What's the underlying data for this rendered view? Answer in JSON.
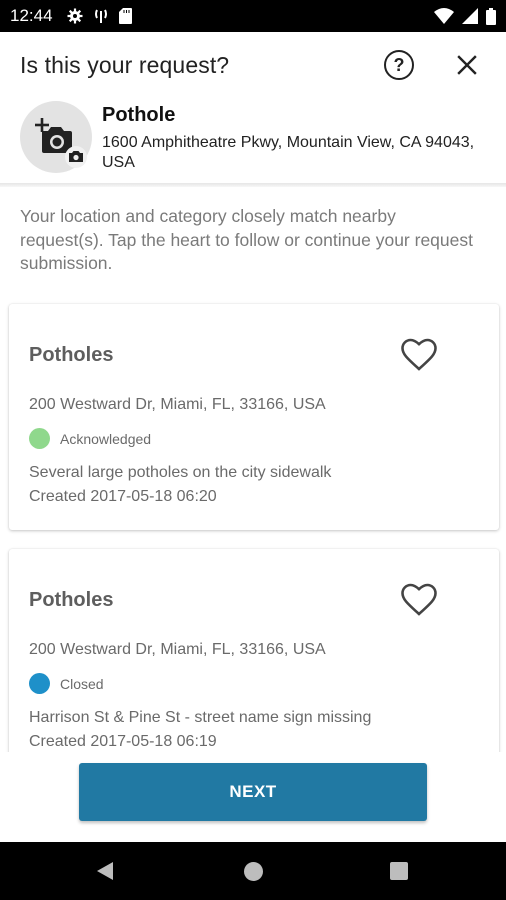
{
  "status_bar": {
    "time": "12:44",
    "left_icons": [
      "gear-icon",
      "antenna-icon",
      "sd-card-icon"
    ],
    "right_icons": [
      "wifi-icon",
      "signal-icon",
      "battery-icon"
    ]
  },
  "header": {
    "title": "Is this your request?",
    "help_icon": "help-circle-icon",
    "close_icon": "close-icon"
  },
  "request": {
    "category": "Pothole",
    "address": "1600 Amphitheatre Pkwy, Mountain View, CA 94043, USA",
    "photo_icon": "add-photo-icon"
  },
  "info_text": "Your location and category closely match nearby request(s). Tap the heart to follow or continue your request submission.",
  "nearby_requests": [
    {
      "title": "Potholes",
      "address": "200 Westward Dr, Miami, FL, 33166, USA",
      "status": "Acknowledged",
      "status_color": "#8fd88c",
      "description": "Several large potholes on the city sidewalk",
      "created": "Created 2017-05-18 06:20",
      "follow_icon": "heart-outline-icon"
    },
    {
      "title": "Potholes",
      "address": "200 Westward Dr, Miami, FL, 33166, USA",
      "status": "Closed",
      "status_color": "#1e90c9",
      "description": "Harrison St & Pine St - street name sign missing",
      "created": "Created 2017-05-18 06:19",
      "follow_icon": "heart-outline-icon"
    }
  ],
  "actions": {
    "next_label": "NEXT",
    "accent_color": "#2179a3"
  },
  "nav_bar": {
    "icons": [
      "back-icon",
      "home-icon",
      "recents-icon"
    ]
  }
}
